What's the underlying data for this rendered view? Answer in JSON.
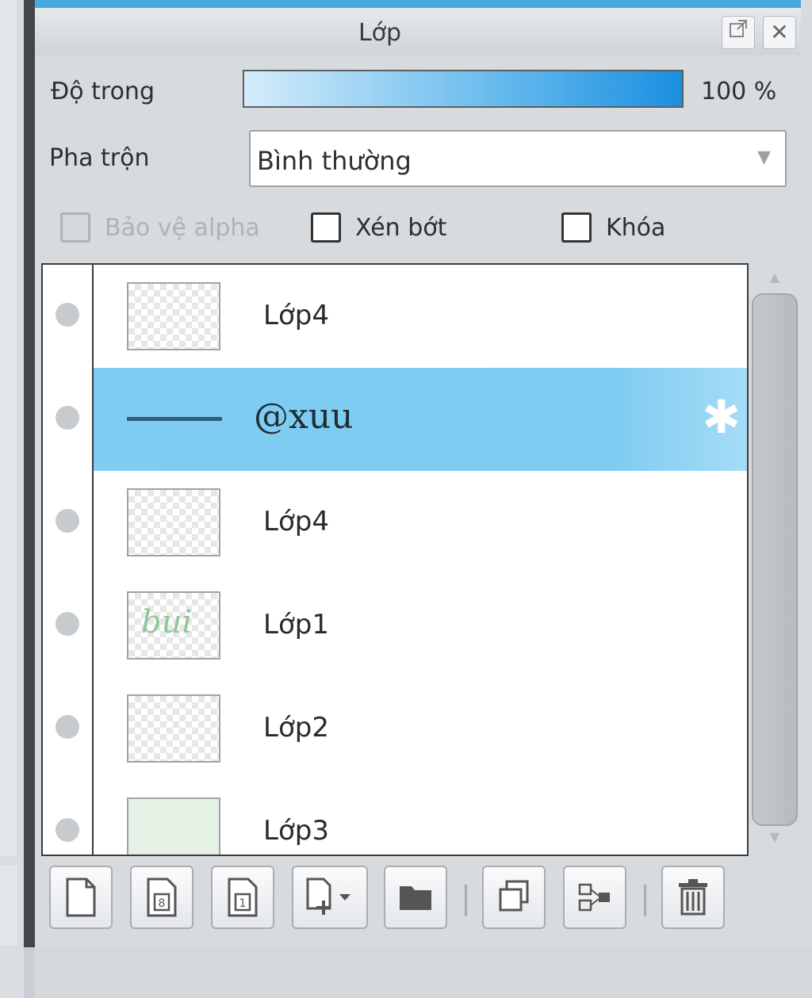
{
  "panel": {
    "title": "Lớp",
    "opacity_label": "Độ trong",
    "opacity_value": "100 %",
    "opacity_fraction": 1.0,
    "blend_label": "Pha trộn",
    "blend_value": "Bình thường",
    "checkboxes": [
      {
        "label": "Bảo vệ alpha",
        "checked": false,
        "enabled": false
      },
      {
        "label": "Xén bớt",
        "checked": false,
        "enabled": true
      },
      {
        "label": "Khóa",
        "checked": false,
        "enabled": true
      }
    ]
  },
  "layers": [
    {
      "name": "Lớp4",
      "selected": false,
      "thumb": "transparent"
    },
    {
      "name": "@xuu",
      "selected": true,
      "thumb": "line",
      "type": "text"
    },
    {
      "name": "Lớp4",
      "selected": false,
      "thumb": "transparent"
    },
    {
      "name": "Lớp1",
      "selected": false,
      "thumb": "doodle"
    },
    {
      "name": "Lớp2",
      "selected": false,
      "thumb": "transparent"
    },
    {
      "name": "Lớp3",
      "selected": false,
      "thumb": "plain"
    }
  ],
  "toolbar": [
    "new-layer-icon",
    "new-8bit-layer-icon",
    "new-1bit-layer-icon",
    "add-layer-dropdown-icon",
    "new-folder-icon",
    "duplicate-layer-icon",
    "merge-layers-icon",
    "delete-layer-icon"
  ],
  "colors": {
    "accent": "#4aa8e0",
    "selected_row": "#7fcdf3",
    "panel_bg": "#d7dbde"
  }
}
